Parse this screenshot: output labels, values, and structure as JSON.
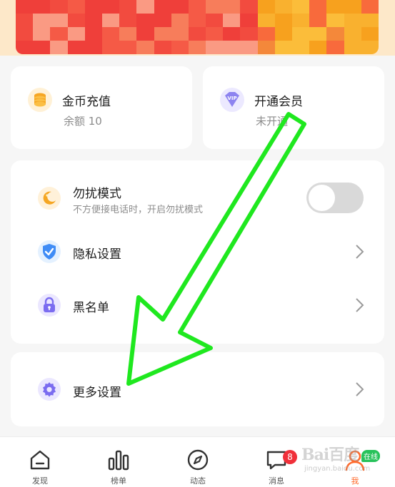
{
  "colors": {
    "accent_orange": "#ff6a2b",
    "annotation_green": "#1fe81f",
    "badge_red": "#f0303a",
    "online_green": "#27c25a",
    "toggle_off": "#d9d9d9"
  },
  "banner": {
    "icon": "pixelated-banner-image"
  },
  "quick_actions": [
    {
      "icon": "gold-coins-icon",
      "title": "金币充值",
      "subtitle": "余额 10"
    },
    {
      "icon": "vip-diamond-icon",
      "title": "开通会员",
      "subtitle": "未开通"
    }
  ],
  "settings": {
    "dnd": {
      "icon": "moon-icon",
      "label": "勿扰模式",
      "description": "不方便接电话时，开启勿扰模式",
      "enabled": false
    },
    "privacy": {
      "icon": "shield-check-icon",
      "label": "隐私设置"
    },
    "blacklist": {
      "icon": "lock-icon",
      "label": "黑名单"
    }
  },
  "more": {
    "icon": "gear-icon",
    "label": "更多设置"
  },
  "bottom_nav": {
    "discover": {
      "icon": "home-icon",
      "label": "发现"
    },
    "rank": {
      "icon": "bar-chart-icon",
      "label": "榜单"
    },
    "feed": {
      "icon": "compass-icon",
      "label": "动态"
    },
    "messages": {
      "icon": "chat-bubble-icon",
      "label": "消息",
      "badge": "8"
    },
    "me": {
      "icon": "person-icon",
      "label": "我",
      "status": "在线",
      "active": true
    }
  },
  "watermark": {
    "text": "Bai百度",
    "sub": "jingyan.baidu.com"
  }
}
